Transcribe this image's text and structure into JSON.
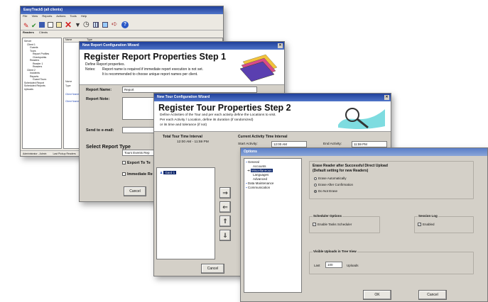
{
  "main_app": {
    "title": "EasyTrack5 (all clients)",
    "menu": [
      "File",
      "View",
      "Reports",
      "Actions",
      "Tools",
      "Help"
    ],
    "tabs": [
      "Readers",
      "Clients"
    ],
    "list_header_name": "Name",
    "list_header_type": "Type",
    "tree_items": [
      "Server",
      "Client 1",
      "Guards",
      "Tours",
      "Report Profiles",
      "Checkpoints",
      "Readers",
      "Reader 1",
      "Readers",
      "Client 2",
      "Incidents",
      "Reports",
      "Guard Tours",
      "Scheduled Report",
      "Scheduled Reports",
      "Uploads"
    ],
    "list_labels": [
      "Name",
      "Type",
      "Client Name",
      "Client Name"
    ],
    "status": [
      "Administrator - Admin",
      "Last Pickup Readers"
    ],
    "status2": "Tours Reports"
  },
  "wizard1": {
    "title": "New Report Configuration Wizard",
    "heading": "Register Report Properties Step 1",
    "define": "Define Report properties.",
    "notes_label": "Notes:",
    "note1": "Report name is required if immediate report execution is not set.",
    "note2": "It is recommended to choose unique report names per client.",
    "report_name_label": "Report Name:",
    "report_name_value": "Report",
    "report_note_label": "Report Note:",
    "send_email_label": "Send to e-mail:",
    "select_type_label": "Select Report Type",
    "type_value": "Tours Events Rep",
    "export_label": "Export To Te",
    "immediate_label": "Immediate Re",
    "cancel": "Cancel"
  },
  "wizard2": {
    "title": "New Tour Configuration Wizard",
    "heading": "Register Tour Properties Step 2",
    "desc1": "Define Activities of the Tour and per each activity define the Locations to visit.",
    "desc2": "Per each Activity / Location, define its duration (if randomized)",
    "desc3": "or its time and tolerance (if not)",
    "total_interval_label": "Total Tour Time Interval",
    "total_interval_value": "12:00 AM - 11:59 PM",
    "current_interval_label": "Current Activity Time Interval",
    "start_label": "Start Activity:",
    "start_value": "12:00 AM",
    "end_label": "End Activity:",
    "end_value": "11:59 PM",
    "list_item": "Gard 1",
    "cancel": "Cancel"
  },
  "options": {
    "title": "Options",
    "tree": [
      "General",
      "Accounts",
      "Miscellaneous",
      "Languages",
      "Advanced",
      "Data Maintenance",
      "Communication"
    ],
    "selected_tree": "Miscellaneous",
    "erase_title": "Erase Reader after Successful Direct Upload",
    "erase_subtitle": "(Default setting for new Readers)",
    "erase_options": [
      "Erase Automatically",
      "Erase After Confirmation",
      "Do Not Erase"
    ],
    "erase_selected": "Do Not Erase",
    "scheduler_title": "Scheduler Options",
    "scheduler_check": "Enable Tasks Scheduler",
    "session_title": "Session Log",
    "session_check": "Enabled",
    "visible_title": "Visible Uploads in Tree View",
    "last_label": "Last",
    "last_value": "100",
    "uploads_label": "Uploads",
    "ok": "OK",
    "cancel": "Cancel"
  }
}
